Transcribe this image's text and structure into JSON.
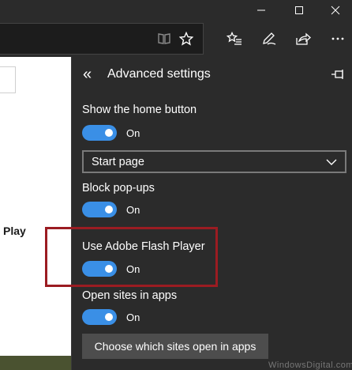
{
  "titlebar": {
    "minimize_glyph": "—",
    "maximize_glyph": "☐",
    "close_glyph": "✕"
  },
  "toolbar": {
    "icons": [
      "reading-view-icon",
      "favorite-star-icon",
      "favorites-hub-icon",
      "web-note-icon",
      "share-icon",
      "more-icon"
    ]
  },
  "page": {
    "text_fragment": "Play"
  },
  "panel": {
    "back_glyph": "«",
    "title": "Advanced settings",
    "home_button": {
      "label": "Show the home button",
      "state": "On"
    },
    "home_select": {
      "value": "Start page"
    },
    "popups": {
      "label": "Block pop-ups",
      "state": "On"
    },
    "flash": {
      "label": "Use Adobe Flash Player",
      "state": "On"
    },
    "open_in_apps": {
      "label": "Open sites in apps",
      "state": "On"
    },
    "choose_sites_button": "Choose which sites open in apps"
  },
  "colors": {
    "toggle_on": "#3a8fe6",
    "highlight": "#9b1c22",
    "background": "#2b2b2b"
  },
  "watermark": "WindowsDigital.com"
}
